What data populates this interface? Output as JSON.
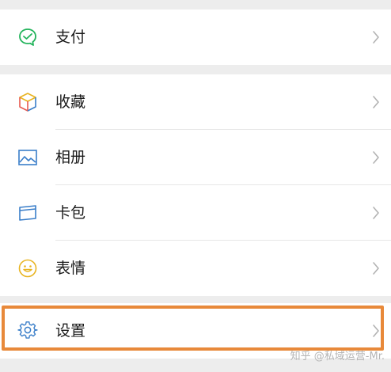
{
  "menu": {
    "payment": {
      "label": "支付",
      "icon": "payment-icon"
    },
    "favorites": {
      "label": "收藏",
      "icon": "favorites-cube-icon"
    },
    "album": {
      "label": "相册",
      "icon": "album-image-icon"
    },
    "cards": {
      "label": "卡包",
      "icon": "card-wallet-icon"
    },
    "stickers": {
      "label": "表情",
      "icon": "smiley-icon"
    },
    "settings": {
      "label": "设置",
      "icon": "gear-icon"
    }
  },
  "colors": {
    "background": "#ededed",
    "row": "#ffffff",
    "highlight": "#e8893a",
    "payment_icon": "#21b35a",
    "icon_blue": "#3a7ec9",
    "icon_yellow": "#e8b421"
  },
  "watermark": "知乎 @私域运营-Mr."
}
